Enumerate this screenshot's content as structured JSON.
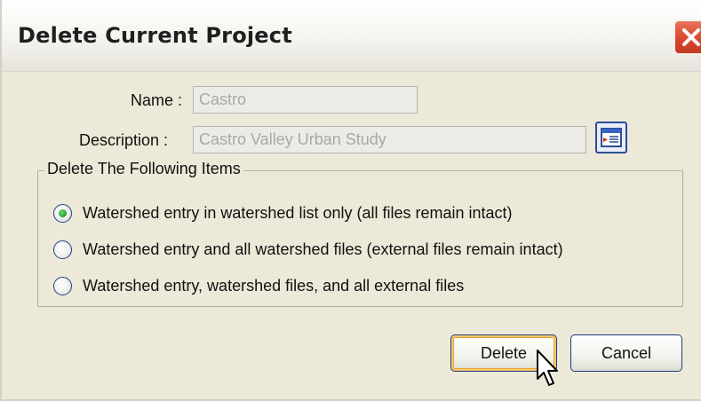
{
  "window": {
    "title": "Delete Current Project"
  },
  "form": {
    "name_label": "Name :",
    "name_value": "Castro",
    "description_label": "Description :",
    "description_value": "Castro Valley Urban Study"
  },
  "delete_group": {
    "legend": "Delete The Following Items",
    "options": [
      {
        "label": "Watershed entry in watershed list only (all files remain intact)",
        "selected": true
      },
      {
        "label": "Watershed entry and all watershed files (external files remain intact)",
        "selected": false
      },
      {
        "label": "Watershed entry, watershed files, and all external files",
        "selected": false
      }
    ]
  },
  "buttons": {
    "delete_label": "Delete",
    "cancel_label": "Cancel"
  },
  "icons": {
    "close": "close-x-icon",
    "browse": "browse-list-icon",
    "cursor": "mouse-pointer-icon"
  },
  "colors": {
    "dialog_bg": "#ece9d8",
    "close_red": "#d9482c",
    "radio_selected": "#1f9a2a",
    "default_button_glow": "#e8a23a"
  }
}
